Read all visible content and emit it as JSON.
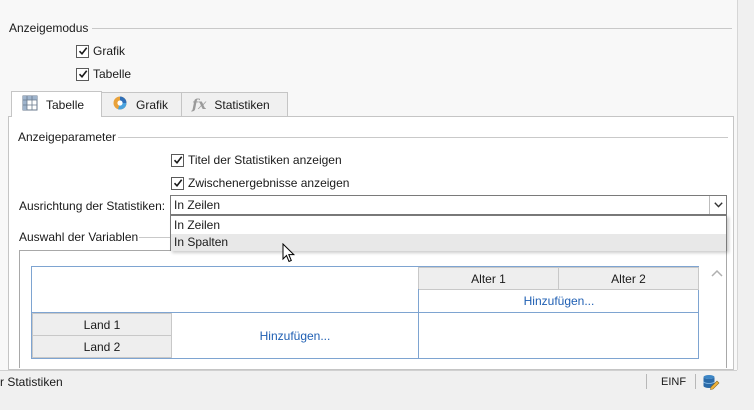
{
  "display_mode": {
    "title": "Anzeigemodus",
    "options": [
      {
        "label": "Grafik",
        "checked": true
      },
      {
        "label": "Tabelle",
        "checked": true
      }
    ]
  },
  "tabs": [
    {
      "label": "Tabelle",
      "icon": "table-grid-icon",
      "active": true
    },
    {
      "label": "Grafik",
      "icon": "pie-chart-icon",
      "active": false
    },
    {
      "label": "Statistiken",
      "icon": "fx-icon",
      "active": false
    }
  ],
  "display_params": {
    "title": "Anzeigeparameter",
    "options": [
      {
        "label": "Titel der Statistiken anzeigen",
        "checked": true
      },
      {
        "label": "Zwischenergebnisse anzeigen",
        "checked": true
      }
    ],
    "orientation_label": "Ausrichtung der Statistiken:",
    "orientation_value": "In Zeilen",
    "orientation_options": [
      "In Zeilen",
      "In Spalten"
    ],
    "hovered_option": "In Spalten"
  },
  "variables": {
    "title": "Auswahl der Variablen",
    "column_headers": [
      "Alter 1",
      "Alter 2"
    ],
    "row_headers": [
      "Land 1",
      "Land 2"
    ],
    "add_column": "Hinzufügen...",
    "add_row": "Hinzufügen..."
  },
  "status_bar": {
    "left_text": "r Statistiken",
    "mode": "EINF"
  },
  "colors": {
    "link": "#1f5fb3",
    "grid_border": "#7ea4d1"
  }
}
